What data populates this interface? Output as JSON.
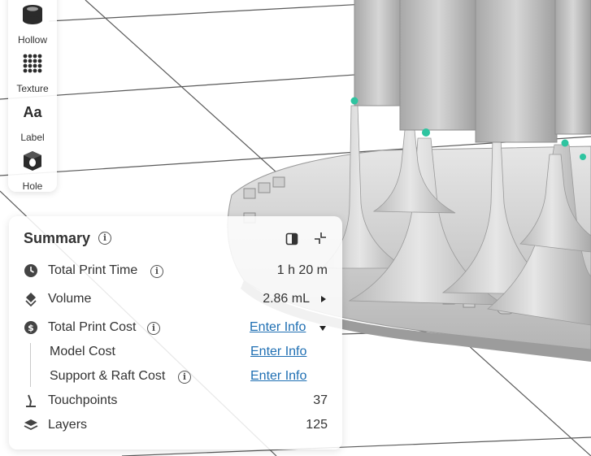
{
  "toolbar": {
    "items": [
      {
        "label": "Hollow",
        "icon": "hollow-icon"
      },
      {
        "label": "Texture",
        "icon": "texture-icon"
      },
      {
        "label": "Label",
        "icon": "label-icon",
        "glyph": "Aa"
      },
      {
        "label": "Hole",
        "icon": "hole-icon"
      }
    ]
  },
  "summary": {
    "title": "Summary",
    "rows": {
      "print_time": {
        "label": "Total Print Time",
        "value": "1 h 20 m"
      },
      "volume": {
        "label": "Volume",
        "value": "2.86 mL"
      },
      "print_cost": {
        "label": "Total Print Cost",
        "link": "Enter Info"
      },
      "model_cost": {
        "label": "Model Cost",
        "link": "Enter Info"
      },
      "support_cost": {
        "label": "Support & Raft Cost",
        "link": "Enter Info"
      },
      "touchpoints": {
        "label": "Touchpoints",
        "value": "37"
      },
      "layers": {
        "label": "Layers",
        "value": "125"
      }
    }
  },
  "colors": {
    "link": "#1f6fb3",
    "model_gray": "#c8c8c8",
    "touchpoint_green": "#2ec4a0"
  }
}
